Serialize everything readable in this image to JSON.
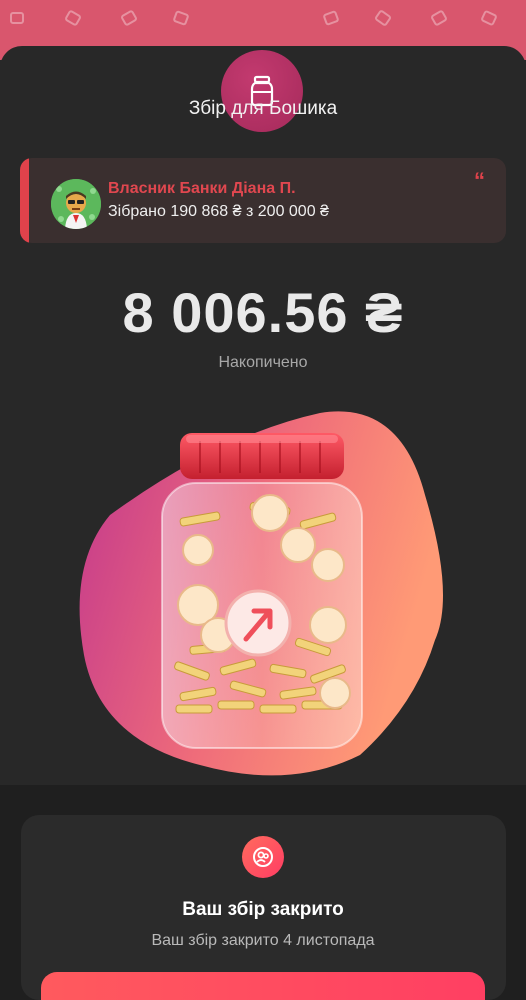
{
  "header": {
    "title": "Збір для Бошика",
    "jar_icon": "jar-icon",
    "pattern_icon": "jar-pattern-icon"
  },
  "owner": {
    "name": "Власник Банки Діана П.",
    "collected": "Зібрано 190 868 ₴ з 200 000 ₴",
    "quote_icon": "quote-icon",
    "quote_glyph": "“"
  },
  "balance": {
    "amount": "8 006.56 ₴",
    "label": "Накопичено"
  },
  "status": {
    "icon": "people-icon",
    "title": "Ваш збір закрито",
    "subtitle": "Ваш збір закрито 4 листопада"
  },
  "colors": {
    "accent": "#e0424b",
    "brand": "#d9566d",
    "background": "#282828"
  }
}
